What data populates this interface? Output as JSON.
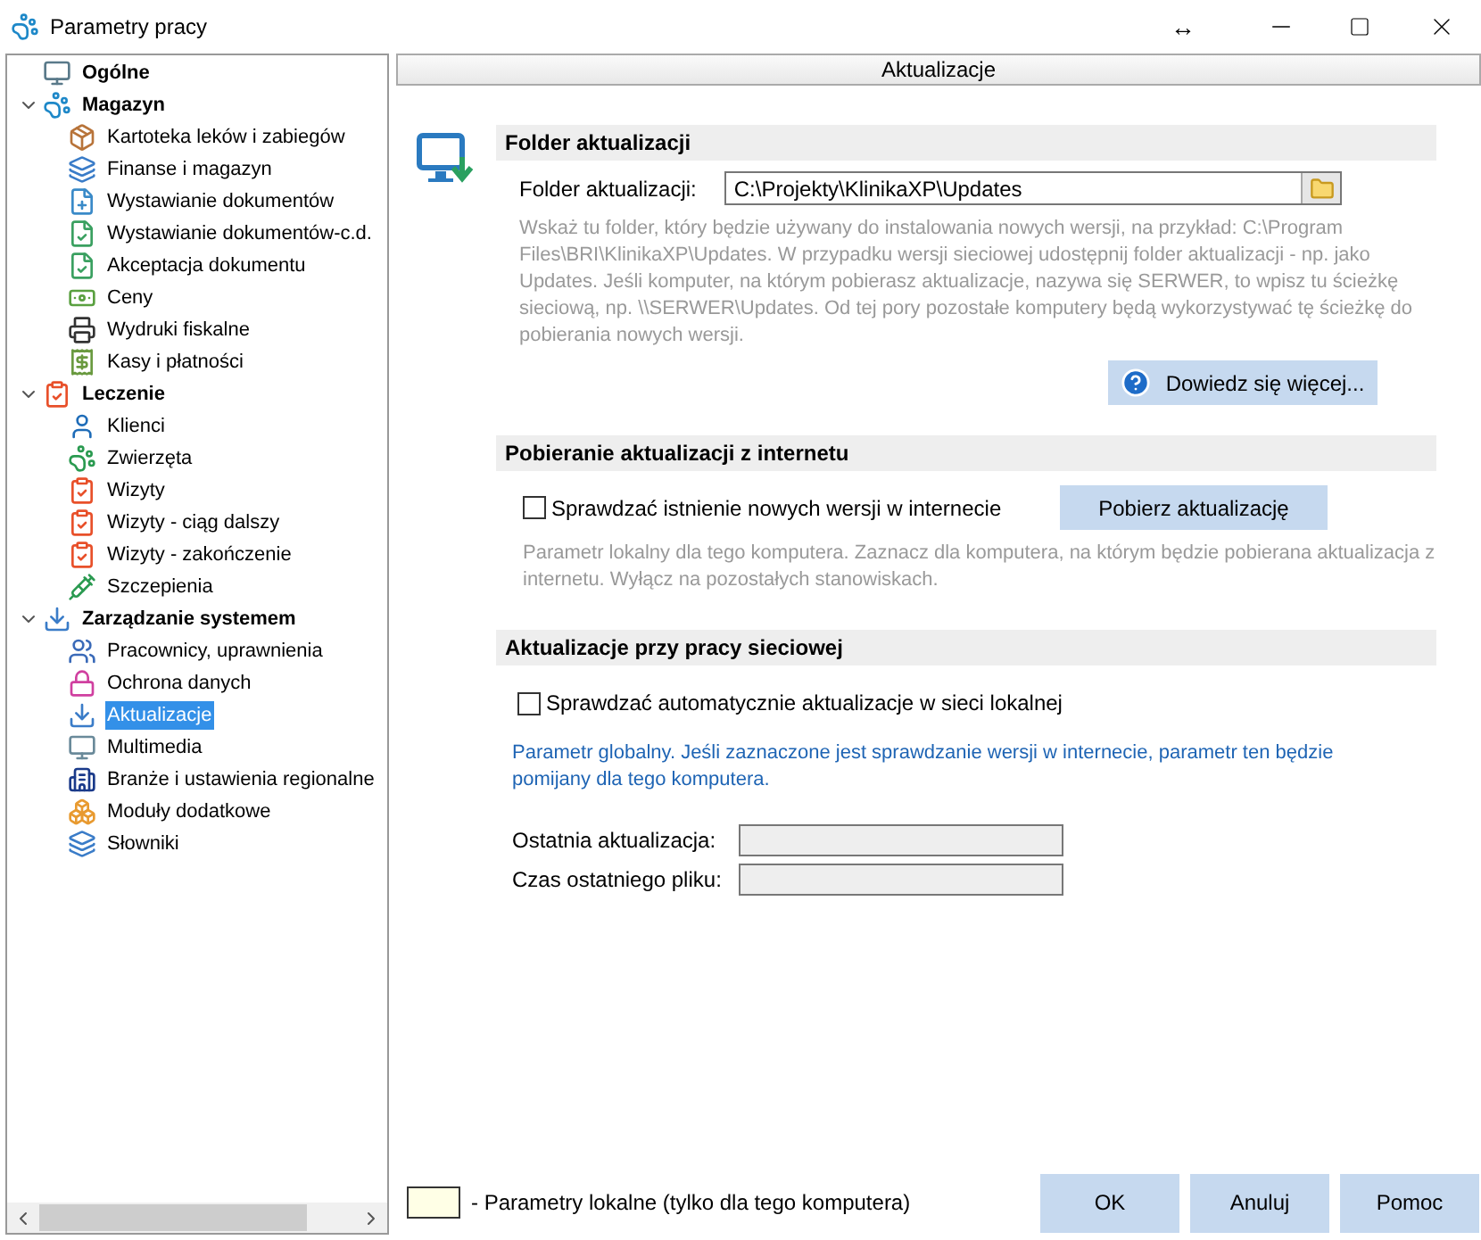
{
  "window": {
    "title": "Parametry pracy",
    "controls": [
      "↔"
    ]
  },
  "tree": [
    {
      "label": "Ogólne",
      "selected": false
    },
    {
      "label": "Magazyn",
      "selected": false,
      "expanded": true,
      "children": [
        {
          "label": "Kartoteka leków i zabiegów",
          "selected": false
        },
        {
          "label": "Finanse i magazyn",
          "selected": false
        },
        {
          "label": "Wystawianie dokumentów",
          "selected": false
        },
        {
          "label": "Wystawianie dokumentów-c.d.",
          "selected": false
        },
        {
          "label": "Akceptacja dokumentu",
          "selected": false
        },
        {
          "label": "Ceny",
          "selected": false
        },
        {
          "label": "Wydruki fiskalne",
          "selected": false
        },
        {
          "label": "Kasy i płatności",
          "selected": false
        }
      ]
    },
    {
      "label": "Leczenie",
      "selected": false,
      "expanded": true,
      "children": [
        {
          "label": "Klienci",
          "selected": false
        },
        {
          "label": "Zwierzęta",
          "selected": false
        },
        {
          "label": "Wizyty",
          "selected": false
        },
        {
          "label": "Wizyty - ciąg dalszy",
          "selected": false
        },
        {
          "label": "Wizyty - zakończenie",
          "selected": false
        },
        {
          "label": "Szczepienia",
          "selected": false
        }
      ]
    },
    {
      "label": "Zarządzanie systemem",
      "selected": false,
      "expanded": true,
      "children": [
        {
          "label": "Pracownicy, uprawnienia",
          "selected": false
        },
        {
          "label": "Ochrona danych",
          "selected": false
        },
        {
          "label": "Aktualizacje",
          "selected": true
        },
        {
          "label": "Multimedia",
          "selected": false
        },
        {
          "label": "Branże i ustawienia regionalne",
          "selected": false
        },
        {
          "label": "Moduły dodatkowe",
          "selected": false
        },
        {
          "label": "Słowniki",
          "selected": false
        }
      ]
    }
  ],
  "panel": {
    "title": "Aktualizacje",
    "folder_section": {
      "heading": "Folder aktualizacji",
      "label": "Folder aktualizacji:",
      "value": "C:\\Projekty\\KlinikaXP\\Updates",
      "description": "Wskaż tu folder, który będzie używany do instalowania nowych wersji, na przykład: C:\\Program Files\\BRI\\KlinikaXP\\Updates. W przypadku wersji sieciowej udostępnij folder  aktualizacji - np. jako Updates. Jeśli komputer, na którym pobierasz aktualizacje, nazywa się SERWER, to wpisz tu ścieżkę sieciową, np. \\\\SERWER\\Updates. Od tej pory pozostałe komputery będą wykorzystywać tę ścieżkę do pobierania nowych wersji.",
      "help_button": "Dowiedz się więcej..."
    },
    "internet_section": {
      "heading": "Pobieranie aktualizacji z internetu",
      "checkbox": {
        "label": "Sprawdzać istnienie nowych wersji w internecie",
        "checked": false
      },
      "button": "Pobierz aktualizację",
      "description": "Parametr lokalny dla tego komputera. Zaznacz dla komputera, na którym będzie pobierana aktualizacja z internetu. Wyłącz na pozostałych stanowiskach."
    },
    "network_section": {
      "heading": "Aktualizacje przy pracy sieciowej",
      "checkbox": {
        "label": "Sprawdzać automatycznie aktualizacje w sieci lokalnej",
        "checked": false
      },
      "description": "Parametr globalny. Jeśli zaznaczone jest sprawdzanie wersji w internecie, parametr ten będzie pomijany dla tego komputera.",
      "fields": [
        {
          "label": "Ostatnia aktualizacja:"
        },
        {
          "label": "Czas ostatniego pliku:"
        }
      ]
    }
  },
  "legend": "- Parametry lokalne (tylko dla tego komputera)",
  "buttons": [
    "OK",
    "Anuluj",
    "Pomoc"
  ]
}
